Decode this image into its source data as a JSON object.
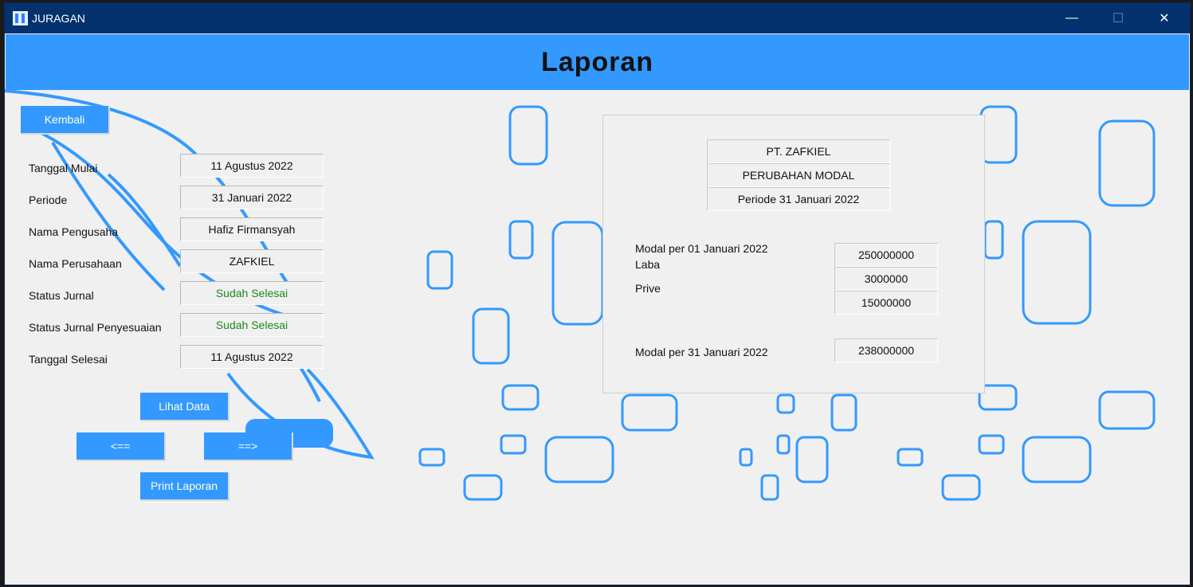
{
  "window": {
    "title": "JURAGAN",
    "minimize": "—",
    "maximize": "☐",
    "close": "✕"
  },
  "header": {
    "title": "Laporan"
  },
  "nav": {
    "back": "Kembali",
    "view_data": "Lihat Data",
    "prev": "<==",
    "next": "==>",
    "print": "Print Laporan"
  },
  "form": {
    "labels": {
      "start_date": "Tanggal Mulai",
      "period": "Periode",
      "owner": "Nama Pengusaha",
      "company": "Nama Perusahaan",
      "journal_status": "Status Jurnal",
      "adjusting_status": "Status Jurnal Penyesuaian",
      "end_date": "Tanggal Selesai"
    },
    "values": {
      "start_date": "11 Agustus 2022",
      "period": "31 Januari 2022",
      "owner": "Hafiz Firmansyah",
      "company": "ZAFKIEL",
      "journal_status": "Sudah Selesai",
      "adjusting_status": "Sudah Selesai",
      "end_date": "11 Agustus 2022"
    }
  },
  "report": {
    "company": "PT. ZAFKIEL",
    "type": "PERUBAHAN MODAL",
    "period": "Periode 31 Januari 2022",
    "rows": [
      {
        "label": "Modal per 01 Januari 2022",
        "value": "250000000"
      },
      {
        "label": "Laba",
        "value": "3000000"
      },
      {
        "label": "Prive",
        "value": "15000000"
      }
    ],
    "total": {
      "label": "Modal per 31 Januari 2022",
      "value": "238000000"
    }
  },
  "colors": {
    "accent": "#3399ff",
    "titlebar": "#03326e",
    "status_green": "#1a8a1a"
  }
}
